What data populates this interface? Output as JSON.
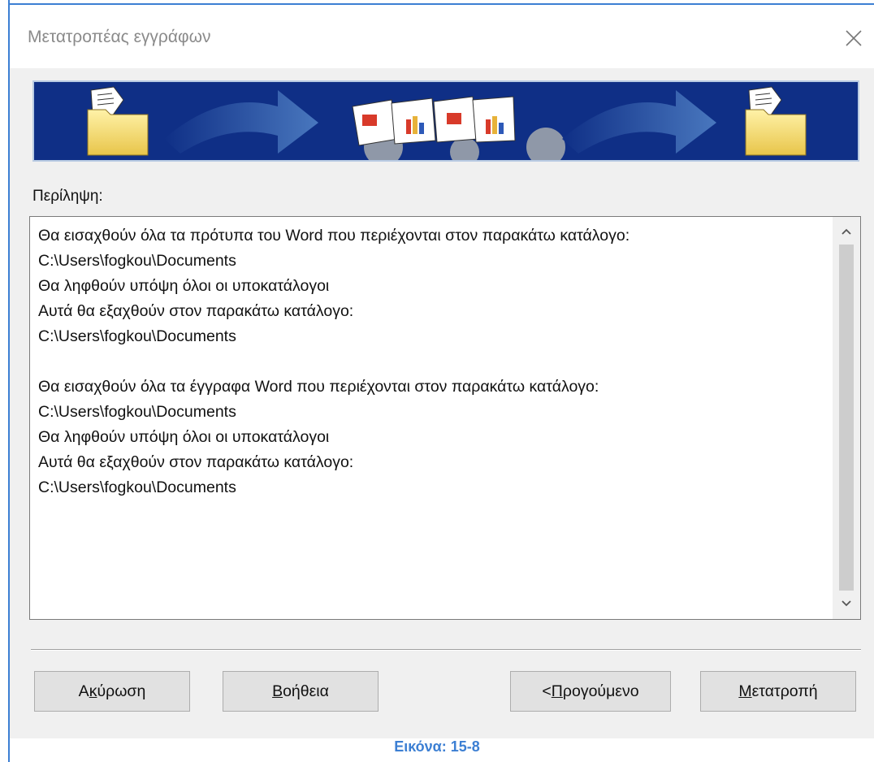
{
  "window": {
    "title": "Μετατροπέας εγγράφων",
    "close_icon": "close-icon"
  },
  "summary": {
    "label": "Περίληψη:",
    "text": "Θα εισαχθούν όλα τα πρότυπα του Word που περιέχονται στον παρακάτω κατάλογο:\nC:\\Users\\fogkou\\Documents\nΘα ληφθούν υπόψη όλοι οι υποκατάλογοι\nΑυτά θα εξαχθούν στον παρακάτω κατάλογο:\nC:\\Users\\fogkou\\Documents\n\nΘα εισαχθούν όλα τα έγγραφα Word που περιέχονται στον παρακάτω κατάλογο:\nC:\\Users\\fogkou\\Documents\nΘα ληφθούν υπόψη όλοι οι υποκατάλογοι\nΑυτά θα εξαχθούν στον παρακάτω κατάλογο:\nC:\\Users\\fogkou\\Documents"
  },
  "buttons": {
    "cancel": {
      "pre": "Α",
      "mnemonic": "κ",
      "post": "ύρωση"
    },
    "help": {
      "pre": "",
      "mnemonic": "Β",
      "post": "οήθεια"
    },
    "back": {
      "pre": "<",
      "mnemonic": "Π",
      "post": "ρογούμενο"
    },
    "convert": {
      "pre": "",
      "mnemonic": "Μ",
      "post": "ετατροπή"
    }
  },
  "caption": "Εικόνα: 15-8",
  "colors": {
    "accent": "#3c7fd3",
    "banner": "#0f2f86"
  }
}
